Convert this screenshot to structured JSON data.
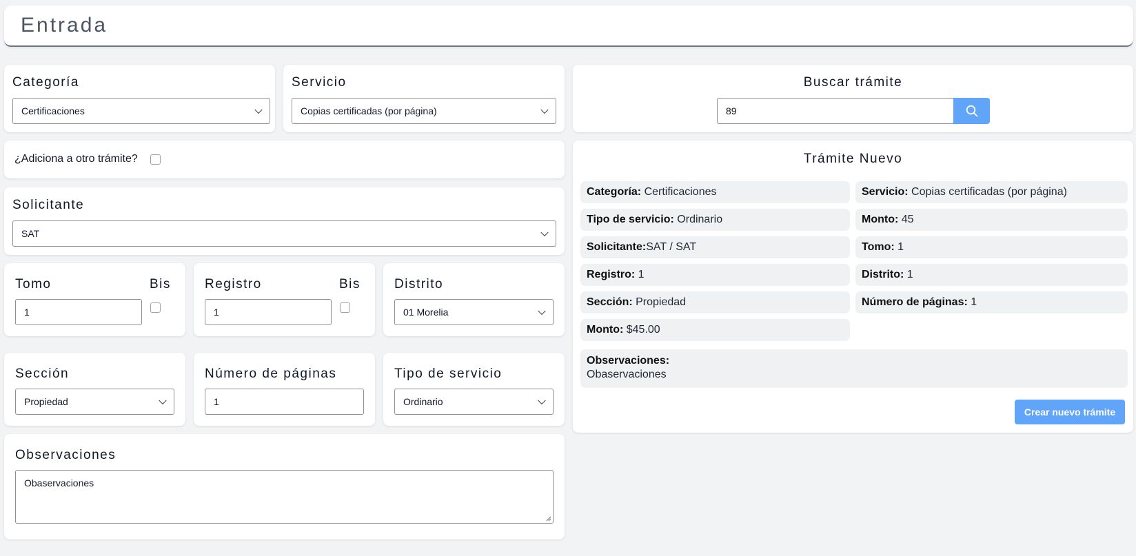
{
  "header": {
    "title": "Entrada"
  },
  "categoria": {
    "label": "Categoría",
    "value": "Certificaciones"
  },
  "servicio": {
    "label": "Servicio",
    "value": "Copias certificadas (por página)"
  },
  "buscar": {
    "label": "Buscar trámite",
    "value": "89",
    "icon": "search-icon"
  },
  "adiciona": {
    "label": "¿Adiciona a otro trámite?",
    "checked": false
  },
  "solicitante": {
    "label": "Solicitante",
    "value": "SAT"
  },
  "tomo": {
    "label": "Tomo",
    "bis_label": "Bis",
    "value": "1"
  },
  "registro": {
    "label": "Registro",
    "bis_label": "Bis",
    "value": "1"
  },
  "distrito": {
    "label": "Distrito",
    "value": "01 Morelia"
  },
  "seccion": {
    "label": "Sección",
    "value": "Propiedad"
  },
  "paginas": {
    "label": "Número de páginas",
    "value": "1"
  },
  "tipo_servicio": {
    "label": "Tipo de servicio",
    "value": "Ordinario"
  },
  "observaciones": {
    "label": "Observaciones",
    "value": "Obaservaciones"
  },
  "tramite_nuevo": {
    "title": "Trámite Nuevo",
    "items": [
      {
        "key": "Categoría:",
        "value": " Certificaciones"
      },
      {
        "key": "Servicio:",
        "value": " Copias certificadas (por página)"
      },
      {
        "key": "Tipo de servicio:",
        "value": " Ordinario"
      },
      {
        "key": "Monto:",
        "value": " 45"
      },
      {
        "key": "Solicitante:",
        "value": "SAT / SAT"
      },
      {
        "key": "Tomo:",
        "value": " 1"
      },
      {
        "key": "Registro:",
        "value": " 1"
      },
      {
        "key": "Distrito:",
        "value": " 1"
      },
      {
        "key": "Sección:",
        "value": " Propiedad"
      },
      {
        "key": "Número de páginas:",
        "value": " 1"
      },
      {
        "key": "Monto:",
        "value": " $45.00"
      }
    ],
    "observaciones_key": "Observaciones:",
    "observaciones_value": "Obaservaciones",
    "create_button": "Crear nuevo trámite"
  },
  "colors": {
    "accent": "#60a5fa",
    "background": "#f2f3f5",
    "info_bg": "#f0f1f3"
  }
}
